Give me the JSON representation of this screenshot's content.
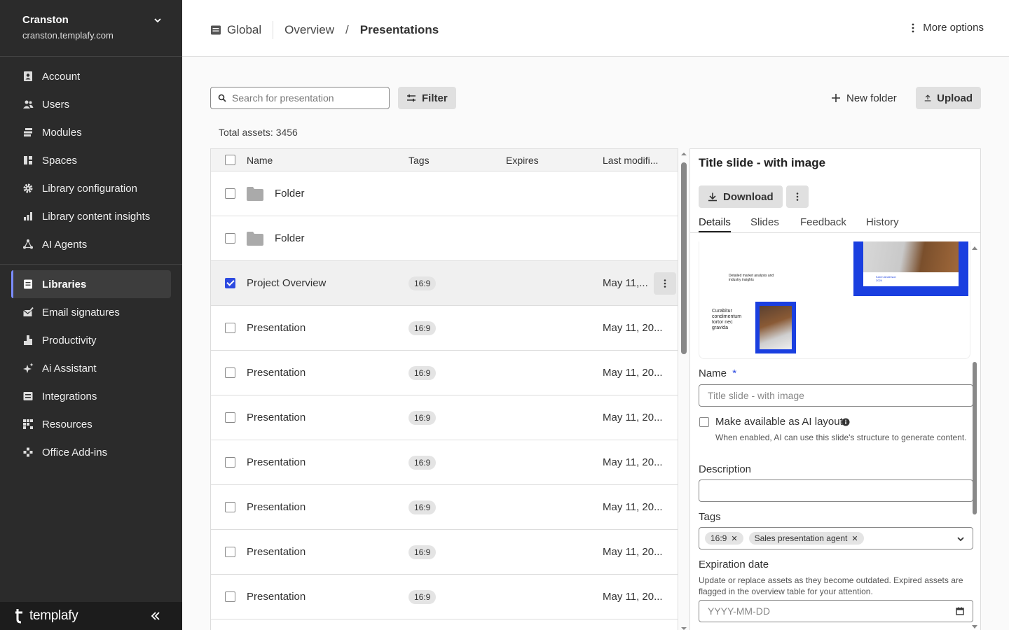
{
  "sidebar": {
    "workspace_name": "Cranston",
    "workspace_url": "cranston.templafy.com",
    "items": [
      {
        "label": "Account",
        "icon": "account-icon"
      },
      {
        "label": "Users",
        "icon": "users-icon"
      },
      {
        "label": "Modules",
        "icon": "modules-icon"
      },
      {
        "label": "Spaces",
        "icon": "spaces-icon"
      },
      {
        "label": "Library configuration",
        "icon": "gear-icon"
      },
      {
        "label": "Library content insights",
        "icon": "bar-chart-icon"
      },
      {
        "label": "AI Agents",
        "icon": "ai-agents-icon"
      },
      {
        "label": "Libraries",
        "icon": "libraries-icon",
        "active": true
      },
      {
        "label": "Email signatures",
        "icon": "email-signature-icon"
      },
      {
        "label": "Productivity",
        "icon": "productivity-icon"
      },
      {
        "label": "Ai Assistant",
        "icon": "sparkle-icon"
      },
      {
        "label": "Integrations",
        "icon": "integrations-icon"
      },
      {
        "label": "Resources",
        "icon": "resources-icon"
      },
      {
        "label": "Office Add-ins",
        "icon": "add-ins-icon"
      }
    ],
    "logo_text": "templafy"
  },
  "header": {
    "space": "Global",
    "crumb_overview": "Overview",
    "crumb_current": "Presentations",
    "more_options": "More options"
  },
  "toolbar": {
    "search_placeholder": "Search for presentation",
    "filter": "Filter",
    "new_folder": "New folder",
    "upload": "Upload"
  },
  "total_assets": "Total assets: 3456",
  "table": {
    "columns": {
      "name": "Name",
      "tags": "Tags",
      "expires": "Expires",
      "modified": "Last modifi..."
    },
    "rows": [
      {
        "name": "Folder",
        "type": "folder",
        "tag": "",
        "modified": "",
        "checked": false
      },
      {
        "name": "Folder",
        "type": "folder",
        "tag": "",
        "modified": "",
        "checked": false
      },
      {
        "name": "Project Overview",
        "type": "file",
        "tag": "16:9",
        "modified": "May 11,...",
        "checked": true
      },
      {
        "name": "Presentation",
        "type": "file",
        "tag": "16:9",
        "modified": "May 11, 20...",
        "checked": false
      },
      {
        "name": "Presentation",
        "type": "file",
        "tag": "16:9",
        "modified": "May 11, 20...",
        "checked": false
      },
      {
        "name": "Presentation",
        "type": "file",
        "tag": "16:9",
        "modified": "May 11, 20...",
        "checked": false
      },
      {
        "name": "Presentation",
        "type": "file",
        "tag": "16:9",
        "modified": "May 11, 20...",
        "checked": false
      },
      {
        "name": "Presentation",
        "type": "file",
        "tag": "16:9",
        "modified": "May 11, 20...",
        "checked": false
      },
      {
        "name": "Presentation",
        "type": "file",
        "tag": "16:9",
        "modified": "May 11, 20...",
        "checked": false
      },
      {
        "name": "Presentation",
        "type": "file",
        "tag": "16:9",
        "modified": "May 11, 20...",
        "checked": false
      }
    ]
  },
  "panel": {
    "title": "Title slide - with image",
    "download": "Download",
    "tabs": [
      "Details",
      "Slides",
      "Feedback",
      "History"
    ],
    "preview": {
      "slide1_text": "Detailed market analysis and industry insights",
      "slide2_name": "Karen Anderson",
      "slide2_year": "2024",
      "slide3_text": "Curabitur condimentum tortor nec gravida"
    },
    "name_label": "Name",
    "required_mark": "*",
    "name_placeholder": "Title slide - with image",
    "ai_layout_label": "Make available as AI layout",
    "ai_layout_hint": "When enabled, AI can use this slide's structure to generate content.",
    "description_label": "Description",
    "tags_label": "Tags",
    "tags": [
      "16:9",
      "Sales presentation agent"
    ],
    "expiration_label": "Expiration date",
    "expiration_hint": "Update or replace assets as they become outdated. Expired assets are flagged in the overview table for your attention.",
    "date_placeholder": "YYYY-MM-DD"
  },
  "colors": {
    "sidebar_bg": "#2b2b2b",
    "accent": "#2d4ae0",
    "active_indicator": "#7b8cff"
  }
}
